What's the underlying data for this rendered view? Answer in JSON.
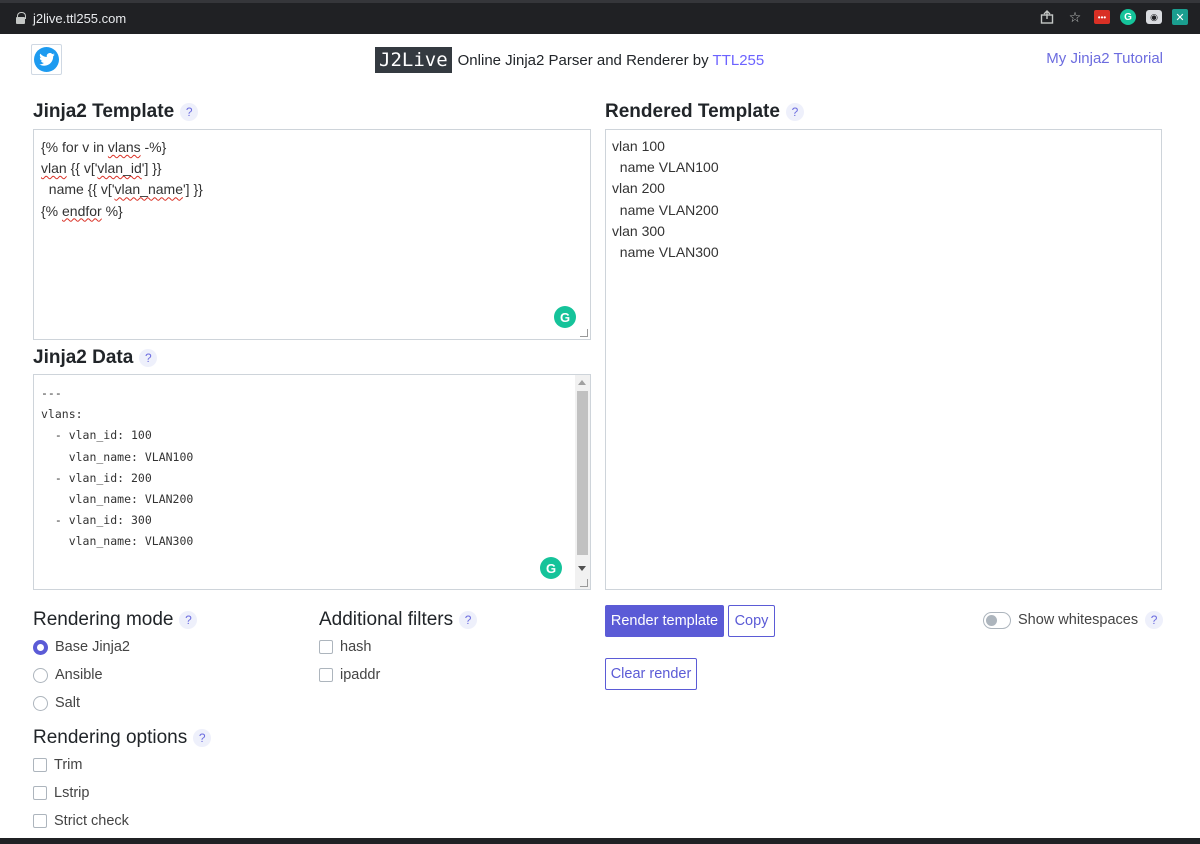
{
  "browser": {
    "url": "j2live.ttl255.com",
    "icons": [
      "lock-icon",
      "share-icon",
      "star-icon",
      "extension-red-icon",
      "grammarly-icon",
      "camera-icon",
      "extension-teal-icon"
    ]
  },
  "header": {
    "logo": "J2Live",
    "subtitle_prefix": "Online Jinja2 Parser and Renderer by",
    "subtitle_link": "TTL255",
    "tutorial_link": "My Jinja2 Tutorial"
  },
  "template_section": {
    "title": "Jinja2 Template",
    "help": "?",
    "lines": [
      [
        "{% for v in ",
        "vlans",
        " -%}"
      ],
      [
        "vlan",
        " {{ v['",
        "vlan_id",
        "'] }}"
      ],
      [
        "  name {{ v['",
        "vlan_name",
        "'] }}"
      ],
      [
        "{% ",
        "endfor",
        " %}"
      ]
    ]
  },
  "data_section": {
    "title": "Jinja2 Data",
    "help": "?",
    "lines": [
      "---",
      "vlans:",
      "  - vlan_id: 100",
      "    vlan_name: VLAN100",
      "  - vlan_id: 200",
      "    vlan_name: VLAN200",
      "  - vlan_id: 300",
      "    vlan_name: VLAN300"
    ]
  },
  "rendered_section": {
    "title": "Rendered Template",
    "help": "?",
    "lines": [
      "vlan 100",
      "  name VLAN100",
      "vlan 200",
      "  name VLAN200",
      "vlan 300",
      "  name VLAN300"
    ]
  },
  "rendering_mode": {
    "title": "Rendering mode",
    "help": "?",
    "options": [
      "Base Jinja2",
      "Ansible",
      "Salt"
    ],
    "selected": "Base Jinja2"
  },
  "additional_filters": {
    "title": "Additional filters",
    "help": "?",
    "options": [
      "hash",
      "ipaddr"
    ]
  },
  "rendering_options": {
    "title": "Rendering options",
    "help": "?",
    "options": [
      "Trim",
      "Lstrip",
      "Strict check"
    ]
  },
  "actions": {
    "render": "Render template",
    "copy": "Copy",
    "clear": "Clear render",
    "show_whitespaces": "Show whitespaces",
    "help": "?"
  },
  "colors": {
    "accent": "#5b5bd6",
    "browser_bar": "#202124",
    "grammarly": "#15c39a",
    "twitter": "#1d9bf0"
  }
}
